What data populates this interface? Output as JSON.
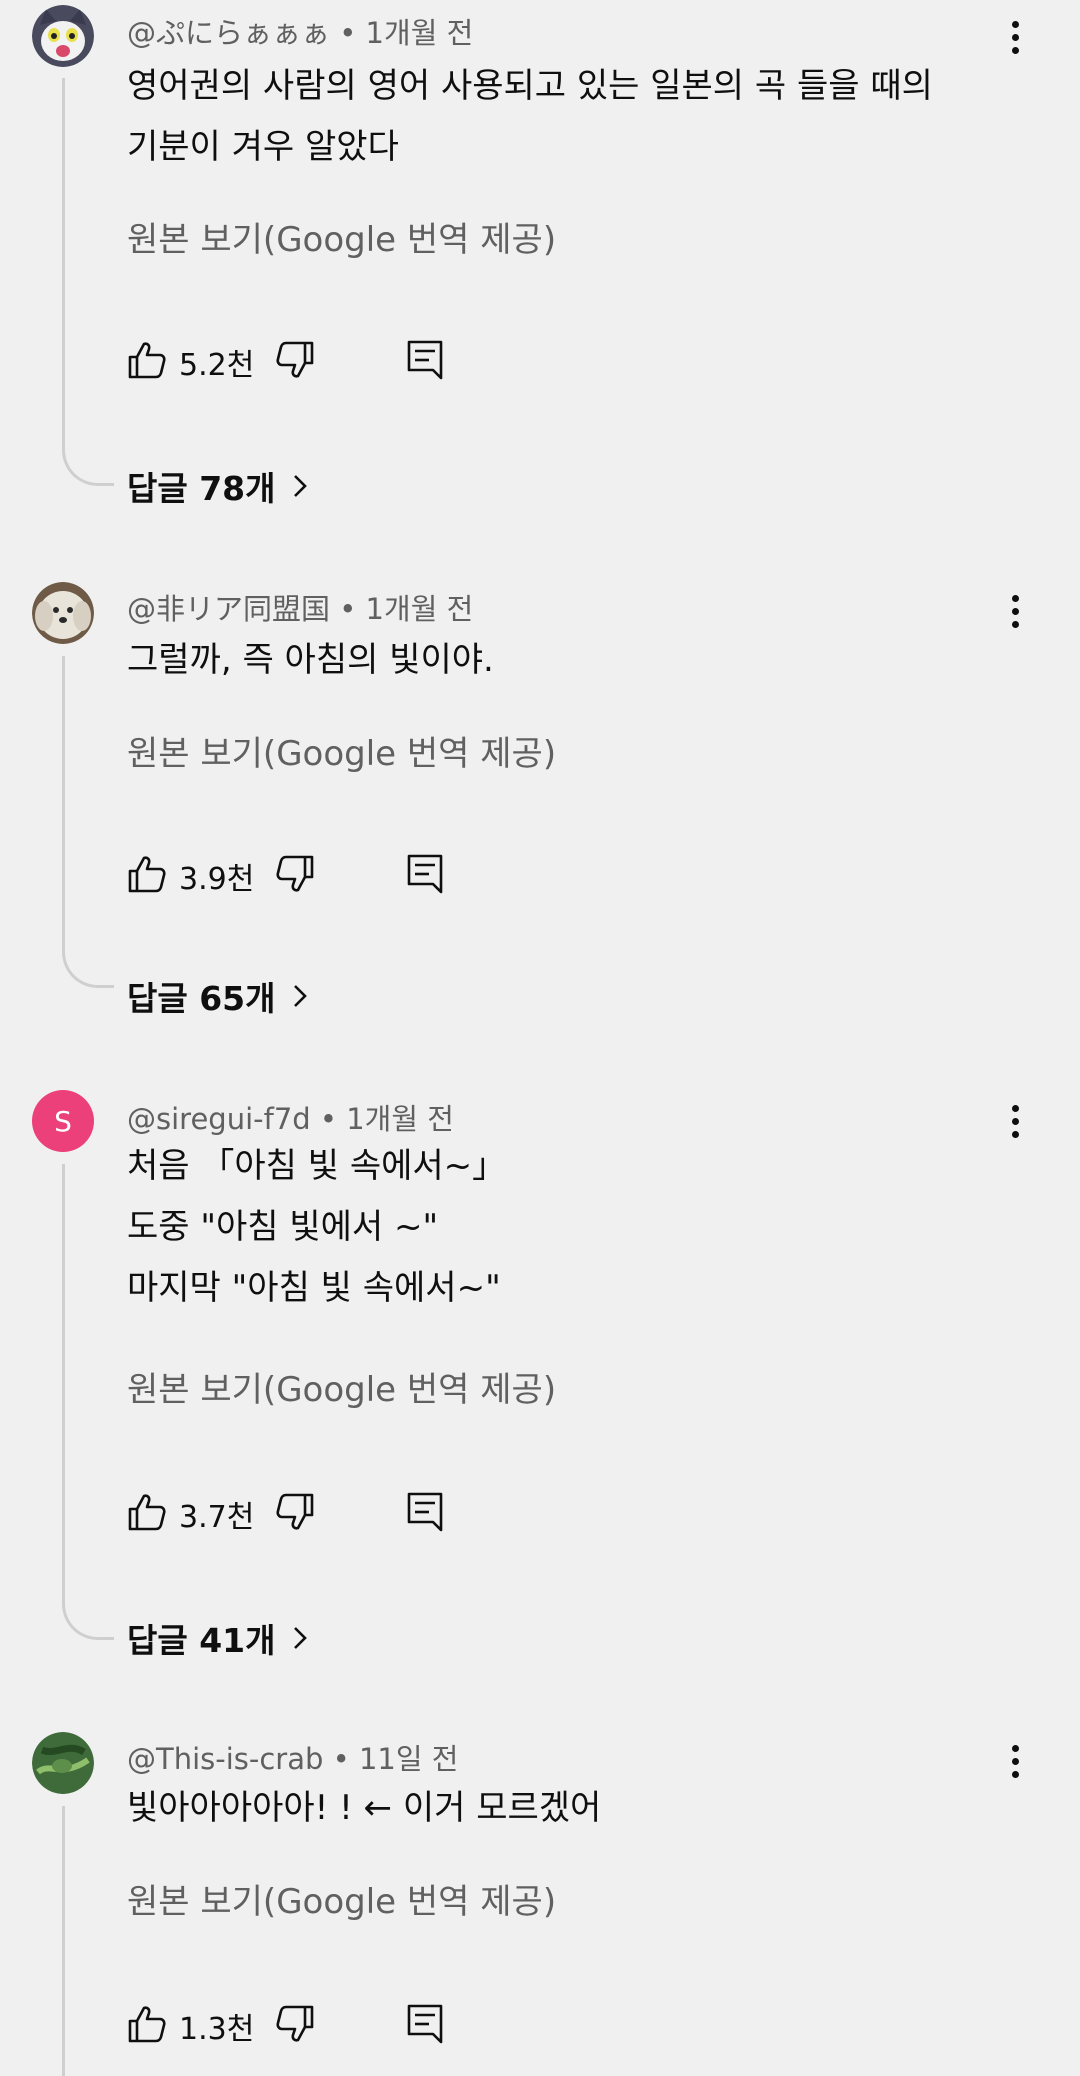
{
  "comments": [
    {
      "author": "@ぷにらぁぁぁ",
      "time": "• 1개월 전",
      "lines": [
        "영어권의 사람의 영어 사용되고 있는 일본의 곡 들을 때의",
        "기분이 겨우 알았다"
      ],
      "translate_label": "원본 보기(Google 번역 제공)",
      "likes": "5.2천",
      "replies_label": "답글 78개",
      "avatar": "cat-avatar"
    },
    {
      "author": "@非リア同盟国",
      "time": "• 1개월 전",
      "lines": [
        "그럴까, 즉 아침의 빛이야."
      ],
      "translate_label": "원본 보기(Google 번역 제공)",
      "likes": "3.9천",
      "replies_label": "답글 65개",
      "avatar": "dog-avatar"
    },
    {
      "author": "@siregui-f7d",
      "time": "• 1개월 전",
      "lines": [
        "처음 「아침 빛 속에서~」",
        "도중 \"아침 빛에서 ~\"",
        "마지막 \"아침 빛 속에서~\""
      ],
      "translate_label": "원본 보기(Google 번역 제공)",
      "likes": "3.7천",
      "replies_label": "답글 41개",
      "avatar_letter": "S",
      "avatar_color": "#ec407a"
    },
    {
      "author": "@This-is-crab",
      "time": "• 11일 전",
      "lines": [
        "빛아아아아아! ! ← 이거 모르겠어"
      ],
      "translate_label": "원본 보기(Google 번역 제공)",
      "likes": "1.3천",
      "avatar": "crab-photo-avatar"
    }
  ],
  "icons": {
    "like": "thumbs-up-icon",
    "dislike": "thumbs-down-icon",
    "reply": "reply-comment-icon",
    "menu": "more-vert-icon",
    "chevron": "chevron-right-icon"
  }
}
